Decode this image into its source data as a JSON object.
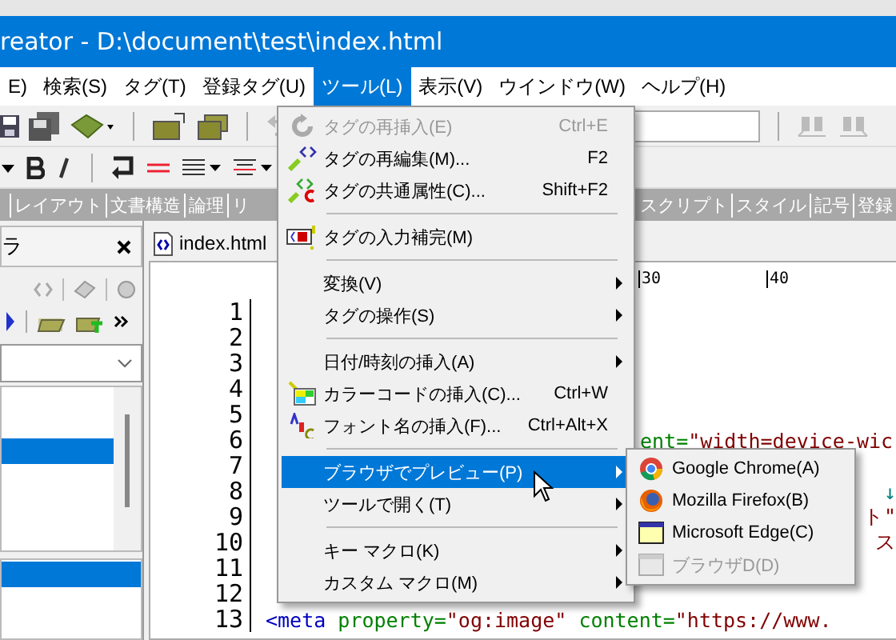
{
  "window": {
    "title": "reator - D:\\document\\test\\index.html"
  },
  "menubar": [
    {
      "label": "E)",
      "selected": false
    },
    {
      "label": "検索(S)",
      "selected": false
    },
    {
      "label": "タグ(T)",
      "selected": false
    },
    {
      "label": "登録タグ(U)",
      "selected": false
    },
    {
      "label": "ツール(L)",
      "selected": true
    },
    {
      "label": "表示(V)",
      "selected": false
    },
    {
      "label": "ウインドウ(W)",
      "selected": false
    },
    {
      "label": "ヘルプ(H)",
      "selected": false
    }
  ],
  "tab_strip": {
    "left": [
      "レイアウト",
      "文書構造",
      "論理",
      "リ"
    ],
    "right": [
      "スクリプト",
      "スタイル",
      "記号",
      "登録"
    ]
  },
  "side_panel": {
    "title": "ラ",
    "list": [
      {
        "selected": false
      },
      {
        "selected": false
      },
      {
        "selected": true
      },
      {
        "selected": false
      },
      {
        "selected": false
      },
      {
        "selected": false
      }
    ],
    "list_2": [
      {
        "selected": true
      },
      {
        "selected": false
      },
      {
        "selected": false
      }
    ]
  },
  "editor": {
    "tab": "index.html",
    "ruler": [
      "30",
      "40"
    ],
    "lines": [
      {
        "number": "1"
      },
      {
        "number": "2"
      },
      {
        "number": "3"
      },
      {
        "number": "4"
      },
      {
        "number": "5"
      },
      {
        "number": "6",
        "kind": "after-menu",
        "segments": [
          {
            "kind": "attr",
            "text": "ent="
          },
          {
            "kind": "value",
            "text": "\"width=device-wic"
          }
        ]
      },
      {
        "number": "7"
      },
      {
        "number": "8",
        "kind": "end",
        "segments": [
          {
            "kind": "mark",
            "text": "↓"
          }
        ]
      },
      {
        "number": "9",
        "kind": "end",
        "segments": [
          {
            "kind": "value",
            "text": "ト\""
          }
        ]
      },
      {
        "number": "10",
        "kind": "end",
        "segments": [
          {
            "kind": "value",
            "text": "ス"
          }
        ]
      },
      {
        "number": "11"
      },
      {
        "number": "12"
      },
      {
        "number": "13",
        "kind": "start",
        "segments": [
          {
            "kind": "tag",
            "text": "<meta"
          },
          {
            "kind": "attr",
            "text": " property="
          },
          {
            "kind": "value",
            "text": "\"og:image\""
          },
          {
            "kind": "attr",
            "text": " content="
          },
          {
            "kind": "value",
            "text": "\"https://www."
          }
        ]
      }
    ]
  },
  "tools_menu": {
    "items": [
      {
        "kind": "item",
        "label": "タグの再挿入(E)",
        "shortcut": "Ctrl+E",
        "disabled": true,
        "selected": false
      },
      {
        "kind": "item",
        "label": "タグの再編集(M)...",
        "shortcut": "F2",
        "disabled": false,
        "selected": false
      },
      {
        "kind": "item",
        "label": "タグの共通属性(C)...",
        "shortcut": "Shift+F2",
        "disabled": false,
        "selected": false
      },
      {
        "kind": "separator"
      },
      {
        "kind": "item",
        "label": "タグの入力補完(M)",
        "disabled": false,
        "selected": false
      },
      {
        "kind": "separator"
      },
      {
        "kind": "submenu",
        "label": "変換(V)",
        "disabled": false,
        "selected": false
      },
      {
        "kind": "submenu",
        "label": "タグの操作(S)",
        "disabled": false,
        "selected": false
      },
      {
        "kind": "separator"
      },
      {
        "kind": "submenu",
        "label": "日付/時刻の挿入(A)",
        "disabled": false,
        "selected": false
      },
      {
        "kind": "item",
        "label": "カラーコードの挿入(C)...",
        "shortcut": "Ctrl+W",
        "disabled": false,
        "selected": false
      },
      {
        "kind": "item",
        "label": "フォント名の挿入(F)...",
        "shortcut": "Ctrl+Alt+X",
        "disabled": false,
        "selected": false
      },
      {
        "kind": "separator"
      },
      {
        "kind": "submenu",
        "label": "ブラウザでプレビュー(P)",
        "disabled": false,
        "selected": true,
        "children": [
          {
            "label": "Google Chrome(A)",
            "disabled": false
          },
          {
            "label": "Mozilla Firefox(B)",
            "disabled": false
          },
          {
            "label": "Microsoft Edge(C)",
            "disabled": false
          },
          {
            "label": "ブラウザD(D)",
            "disabled": true
          }
        ]
      },
      {
        "kind": "submenu",
        "label": "ツールで開く(T)",
        "disabled": false,
        "selected": false
      },
      {
        "kind": "separator"
      },
      {
        "kind": "submenu",
        "label": "キー マクロ(K)",
        "disabled": false,
        "selected": false
      },
      {
        "kind": "submenu",
        "label": "カスタム マクロ(M)",
        "disabled": false,
        "selected": false
      }
    ]
  }
}
